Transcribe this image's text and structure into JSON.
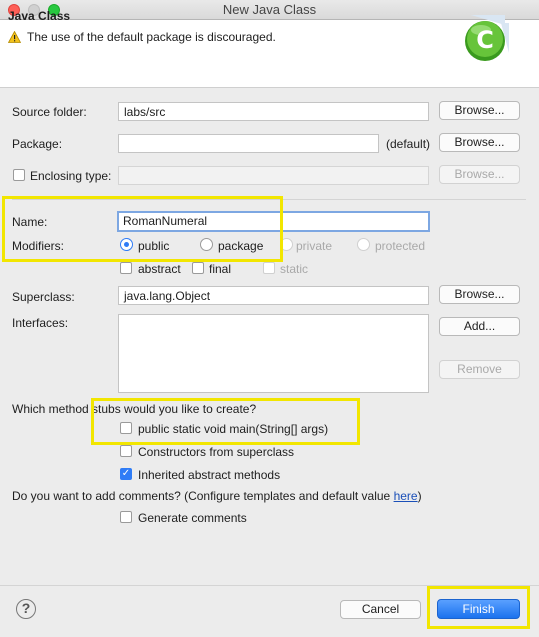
{
  "window": {
    "title": "New Java Class"
  },
  "header": {
    "title": "Java Class",
    "message": "The use of the default package is discouraged.",
    "warning_icon": "warning-icon",
    "logo_icon": "eclipse-class-wizard-logo",
    "logo_letter": "C"
  },
  "form": {
    "source_folder": {
      "label": "Source folder:",
      "value": "labs/src",
      "button": "Browse..."
    },
    "package": {
      "label": "Package:",
      "value": "",
      "suffix": "(default)",
      "button": "Browse..."
    },
    "enclosing_type": {
      "label": "Enclosing type:",
      "value": "",
      "button": "Browse..."
    },
    "name": {
      "label": "Name:",
      "value": "RomanNumeral"
    },
    "modifiers": {
      "label": "Modifiers:",
      "access": [
        "public",
        "package",
        "private",
        "protected"
      ],
      "selected": "public",
      "flags": [
        "abstract",
        "final",
        "static"
      ]
    },
    "superclass": {
      "label": "Superclass:",
      "value": "java.lang.Object",
      "button": "Browse..."
    },
    "interfaces": {
      "label": "Interfaces:",
      "add_button": "Add...",
      "remove_button": "Remove"
    },
    "stubs": {
      "question": "Which method stubs would you like to create?",
      "options": [
        {
          "label": "public static void main(String[] args)",
          "checked": false
        },
        {
          "label": "Constructors from superclass",
          "checked": false
        },
        {
          "label": "Inherited abstract methods",
          "checked": true
        }
      ]
    },
    "comments": {
      "question": "Do you want to add comments? (Configure templates and default value ",
      "link": "here",
      "question_end": ")",
      "option": {
        "label": "Generate comments",
        "checked": false
      }
    }
  },
  "footer": {
    "help": "?",
    "cancel": "Cancel",
    "finish": "Finish"
  },
  "colors": {
    "highlight": "#f2e600",
    "accent": "#2f7cf6"
  }
}
